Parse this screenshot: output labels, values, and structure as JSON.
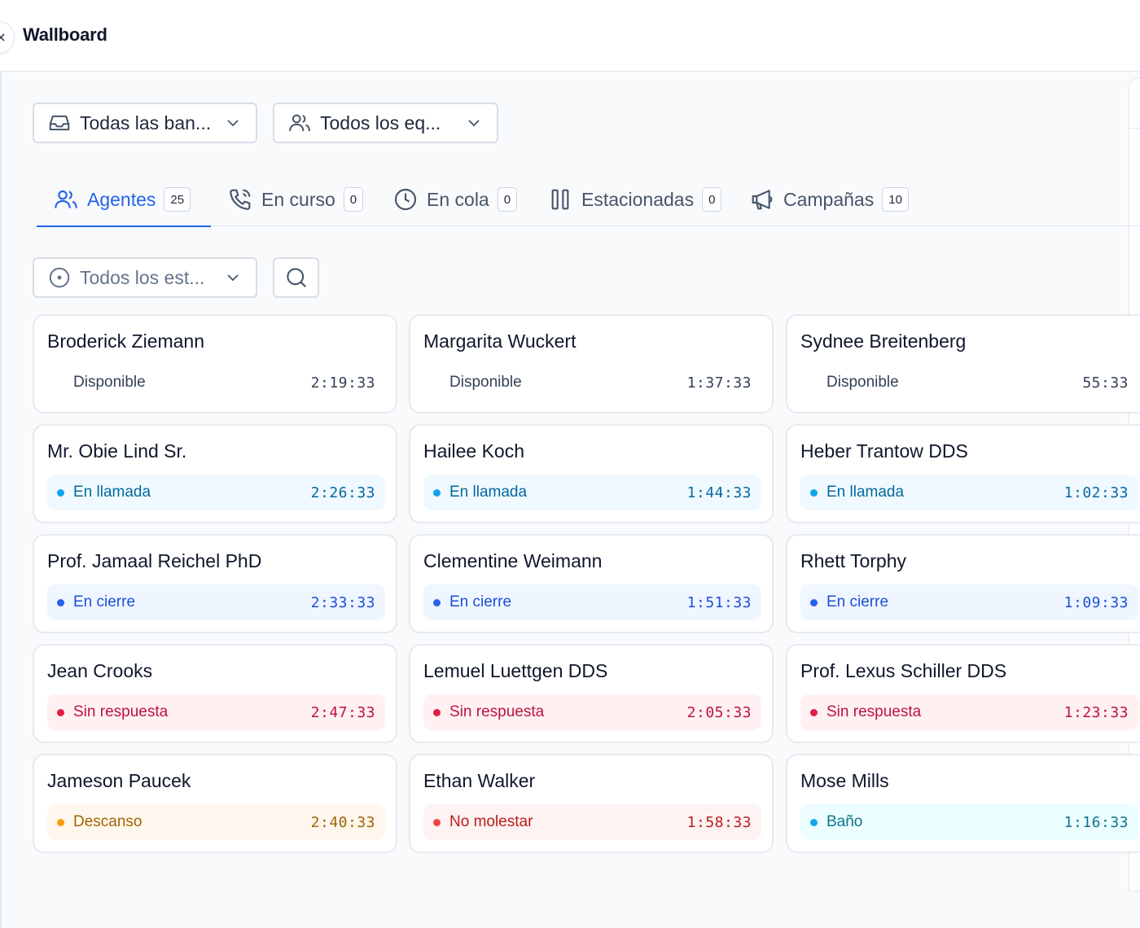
{
  "header": {
    "title": "Wallboard"
  },
  "filters": {
    "inbox": "Todas las ban...",
    "team": "Todos los eq...",
    "status": "Todos los est..."
  },
  "tabs": [
    {
      "label": "Agentes",
      "count": "25"
    },
    {
      "label": "En curso",
      "count": "0"
    },
    {
      "label": "En cola",
      "count": "0"
    },
    {
      "label": "Estacionadas",
      "count": "0"
    },
    {
      "label": "Campañas",
      "count": "10"
    }
  ],
  "colors": {
    "accent": "#2563eb",
    "disponible_bg": "#ffffff",
    "llamada_bg": "#f0f9ff",
    "llamada_dot": "#0ea5e9",
    "llamada_text": "#0369a1",
    "cierre_bg": "#eff6ff",
    "cierre_dot": "#2563eb",
    "cierre_text": "#1d4ed8",
    "sinresp_bg": "#fff1f2",
    "sinresp_dot": "#e11d48",
    "sinresp_text": "#be123c",
    "descanso_bg": "#fff7ed",
    "descanso_dot": "#f59e0b",
    "descanso_text": "#a16207",
    "molestar_bg": "#fef2f2",
    "molestar_dot": "#ef4444",
    "molestar_text": "#b91c1c",
    "bano_bg": "#ecfeff",
    "bano_dot": "#0ea5e9",
    "bano_text": "#0e7490"
  },
  "agents": [
    {
      "name": "Broderick Ziemann",
      "status": "Disponible",
      "time": "2:19:33",
      "kind": "disponible"
    },
    {
      "name": "Margarita Wuckert",
      "status": "Disponible",
      "time": "1:37:33",
      "kind": "disponible"
    },
    {
      "name": "Sydnee Breitenberg",
      "status": "Disponible",
      "time": "55:33",
      "kind": "disponible"
    },
    {
      "name": "Mr. Obie Lind Sr.",
      "status": "En llamada",
      "time": "2:26:33",
      "kind": "llamada"
    },
    {
      "name": "Hailee Koch",
      "status": "En llamada",
      "time": "1:44:33",
      "kind": "llamada"
    },
    {
      "name": "Heber Trantow DDS",
      "status": "En llamada",
      "time": "1:02:33",
      "kind": "llamada"
    },
    {
      "name": "Prof. Jamaal Reichel PhD",
      "status": "En cierre",
      "time": "2:33:33",
      "kind": "cierre"
    },
    {
      "name": "Clementine Weimann",
      "status": "En cierre",
      "time": "1:51:33",
      "kind": "cierre"
    },
    {
      "name": "Rhett Torphy",
      "status": "En cierre",
      "time": "1:09:33",
      "kind": "cierre"
    },
    {
      "name": "Jean Crooks",
      "status": "Sin respuesta",
      "time": "2:47:33",
      "kind": "sinresp"
    },
    {
      "name": "Lemuel Luettgen DDS",
      "status": "Sin respuesta",
      "time": "2:05:33",
      "kind": "sinresp"
    },
    {
      "name": "Prof. Lexus Schiller DDS",
      "status": "Sin respuesta",
      "time": "1:23:33",
      "kind": "sinresp"
    },
    {
      "name": "Jameson Paucek",
      "status": "Descanso",
      "time": "2:40:33",
      "kind": "descanso"
    },
    {
      "name": "Ethan Walker",
      "status": "No molestar",
      "time": "1:58:33",
      "kind": "molestar"
    },
    {
      "name": "Mose Mills",
      "status": "Baño",
      "time": "1:16:33",
      "kind": "bano"
    }
  ]
}
